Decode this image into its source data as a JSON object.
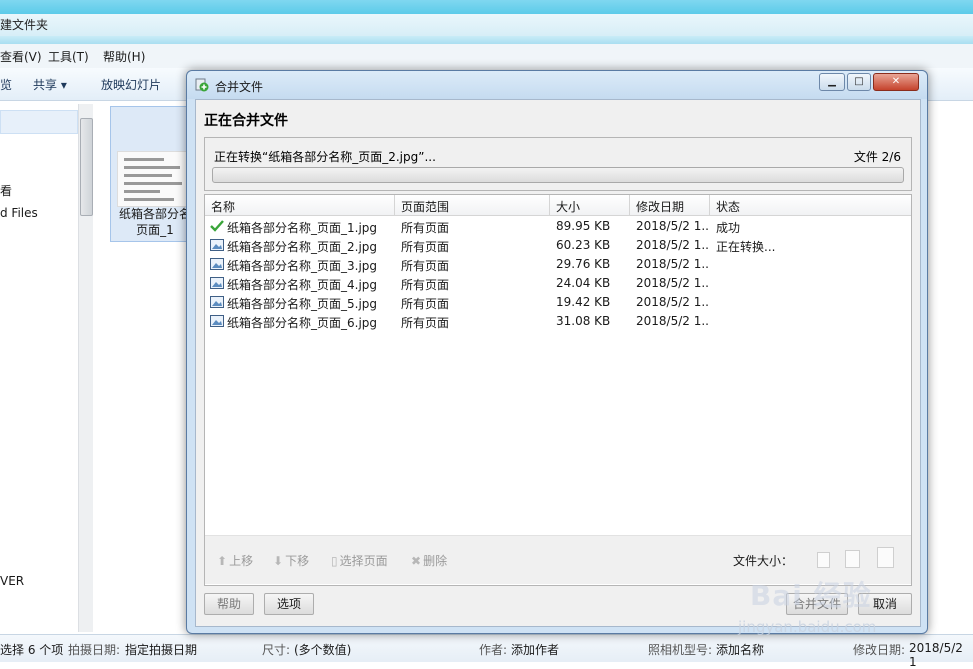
{
  "explorer": {
    "window_title": "建文件夹",
    "menu": [
      "查看(V)",
      "工具(T)",
      "帮助(H)"
    ],
    "toolbar": [
      "览",
      "共享 ▾",
      "放映幻灯片"
    ],
    "nav_items": [
      "看",
      "d Files",
      "VER"
    ],
    "file": {
      "label_line1": "纸箱各部分名",
      "label_line2": "页面_1"
    },
    "status": {
      "selection": "选择 6 个项",
      "date_key": "拍摄日期:",
      "date_val": "指定拍摄日期",
      "size_key": "尺寸:",
      "size_val": "(多个数值)",
      "author_key": "作者:",
      "author_val": "添加作者",
      "camera_key": "照相机型号:",
      "camera_val": "添加名称",
      "modified_key": "修改日期:",
      "modified_val": "2018/5/2 1"
    }
  },
  "dialog": {
    "title": "合并文件",
    "heading": "正在合并文件",
    "progress": {
      "message": "正在转换“纸箱各部分名称_页面_2.jpg”...",
      "count": "文件 2/6",
      "fraction": 0.0
    },
    "columns": [
      "名称",
      "页面范围",
      "大小",
      "修改日期",
      "状态"
    ],
    "rows": [
      {
        "name": "纸箱各部分名称_页面_1.jpg",
        "range": "所有页面",
        "size": "89.95 KB",
        "date": "2018/5/2 1...",
        "status": "成功",
        "icon": "check-icon"
      },
      {
        "name": "纸箱各部分名称_页面_2.jpg",
        "range": "所有页面",
        "size": "60.23 KB",
        "date": "2018/5/2 1...",
        "status": "正在转换...",
        "icon": "image-file-icon"
      },
      {
        "name": "纸箱各部分名称_页面_3.jpg",
        "range": "所有页面",
        "size": "29.76 KB",
        "date": "2018/5/2 1...",
        "status": "",
        "icon": "image-file-icon"
      },
      {
        "name": "纸箱各部分名称_页面_4.jpg",
        "range": "所有页面",
        "size": "24.04 KB",
        "date": "2018/5/2 1...",
        "status": "",
        "icon": "image-file-icon"
      },
      {
        "name": "纸箱各部分名称_页面_5.jpg",
        "range": "所有页面",
        "size": "19.42 KB",
        "date": "2018/5/2 1...",
        "status": "",
        "icon": "image-file-icon"
      },
      {
        "name": "纸箱各部分名称_页面_6.jpg",
        "range": "所有页面",
        "size": "31.08 KB",
        "date": "2018/5/2 1...",
        "status": "",
        "icon": "image-file-icon"
      }
    ],
    "list_toolbar": {
      "move_up": "上移",
      "move_down": "下移",
      "select_pages": "选择页面",
      "delete": "删除",
      "file_size": "文件大小："
    },
    "buttons": {
      "help": "帮助",
      "options": "选项",
      "merge": "合并文件",
      "cancel": "取消"
    }
  },
  "watermark": {
    "text": "Bai 经验",
    "url": "jingyan.baidu.com"
  }
}
